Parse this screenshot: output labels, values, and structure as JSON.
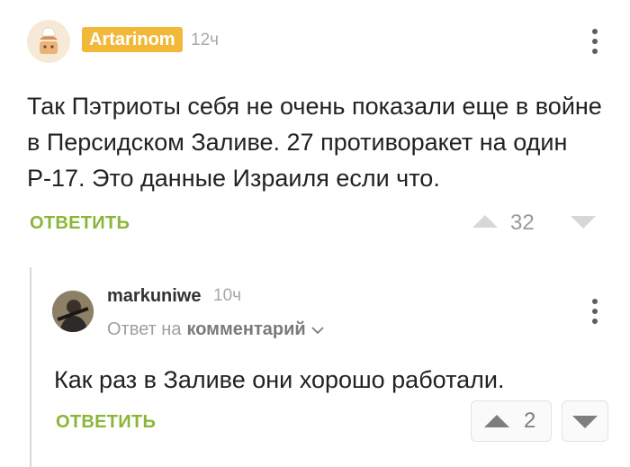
{
  "comment1": {
    "username": "Artarinom",
    "time": "12ч",
    "text": "Так Пэтриоты себя не очень показали еще в войне в Персидском Заливе. 27 противоракет на один Р-17. Это данные Израиля если что.",
    "reply_label": "ОТВЕТИТЬ",
    "score": "32"
  },
  "comment2": {
    "username": "markuniwe",
    "time": "10ч",
    "reply_to_prefix": "Ответ на",
    "reply_to_target": "комментарий",
    "text": "Как раз в Заливе они хорошо работали.",
    "reply_label": "ОТВЕТИТЬ",
    "score": "2"
  },
  "colors": {
    "badge": "#f2b83a",
    "reply_green": "#8ab637"
  }
}
